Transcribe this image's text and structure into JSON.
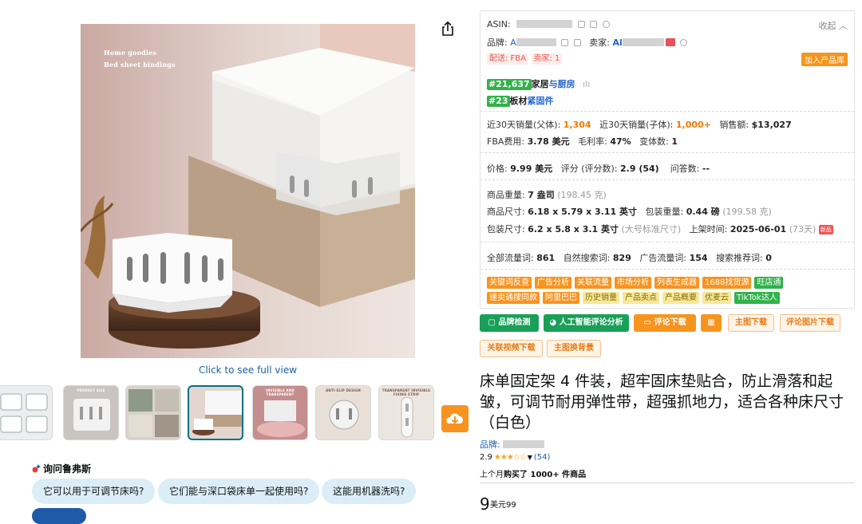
{
  "gallery": {
    "image_text": [
      "Home goodies",
      "Bed sheet bindings"
    ],
    "click_full_view": "Click to see full view",
    "thumbnails": [
      {
        "caption": ""
      },
      {
        "caption": "PRODUCT SIZE"
      },
      {
        "caption": ""
      },
      {
        "caption": "",
        "active": true
      },
      {
        "caption": "INVISIBLE AND TRANSPARENT"
      },
      {
        "caption": "ANTI-SLIP DESIGN"
      },
      {
        "caption": "TRANSPARENT INVISIBLE FIXING STRIP"
      }
    ]
  },
  "rufus": {
    "title": "询问鲁弗斯",
    "questions": [
      "它可以用于可调节床吗?",
      "它们能与深口袋床单一起使用吗?",
      "这能用机器洗吗?"
    ]
  },
  "panel": {
    "asin_label": "ASIN:",
    "collapse": "收起",
    "brand_label": "品牌:",
    "brand_partial": "A",
    "seller_label": "卖家:",
    "seller_partial": "Al",
    "delivery_tag": "配送: FBA",
    "seller_count_tag": "卖家: 1",
    "add_to_library": "加入产品库",
    "rank1": {
      "rank": "#21,637",
      "category_a": "家居",
      "category_b": "与厨房"
    },
    "rank2": {
      "rank": "#23",
      "category_a": "板材",
      "category_b": "紧固件"
    },
    "sales_parent_label": "近30天销量(父体):",
    "sales_parent": "1,304",
    "sales_child_label": "近30天销量(子体):",
    "sales_child": "1,000+",
    "revenue_label": "销售额:",
    "revenue": "$13,027",
    "fba_label": "FBA费用:",
    "fba": "3.78 美元",
    "margin_label": "毛利率:",
    "margin": "47%",
    "variants_label": "变体数:",
    "variants": "1",
    "price_label": "价格:",
    "price": "9.99 美元",
    "rating_label": "评分 (评分数):",
    "rating": "2.9 (54)",
    "qa_label": "问答数:",
    "qa": "--",
    "weight_label": "商品重量:",
    "weight": "7 盎司",
    "weight_g": "(198.45 克)",
    "dims_label": "商品尺寸:",
    "dims": "6.18 x 5.79 x 3.11 英寸",
    "pkg_weight_label": "包装重量:",
    "pkg_weight": "0.44 磅",
    "pkg_weight_g": "(199.58 克)",
    "pkg_dims_label": "包装尺寸:",
    "pkg_dims": "6.2 x 5.8 x 3.1 英寸",
    "pkg_size_class": "(大号标准尺寸)",
    "listed_label": "上架时间:",
    "listed_date": "2025-06-01",
    "listed_days": "(73天)",
    "new_badge": "新品",
    "all_kw_label": "全部流量词:",
    "all_kw": "861",
    "organic_label": "自然搜索词:",
    "organic": "829",
    "ad_label": "广告流量词:",
    "ad": "154",
    "suggest_label": "搜索推荐词:",
    "suggest": "0",
    "tools_row1": [
      {
        "label": "关键词反查",
        "style": "o"
      },
      {
        "label": "广告分析",
        "style": "o"
      },
      {
        "label": "关联流量",
        "style": "o"
      },
      {
        "label": "市场分析",
        "style": "o"
      },
      {
        "label": "列表生成器",
        "style": "o"
      },
      {
        "label": "1688找货源",
        "style": "o"
      },
      {
        "label": "旺店通",
        "style": "g"
      }
    ],
    "tools_row2": [
      {
        "label": "速卖通搜同款",
        "style": "o"
      },
      {
        "label": "阿里巴巴",
        "style": "o"
      },
      {
        "label": "历史销量",
        "style": "y"
      },
      {
        "label": "产品卖点",
        "style": "y"
      },
      {
        "label": "产品概要",
        "style": "y"
      },
      {
        "label": "优麦云",
        "style": "y"
      },
      {
        "label": "TikTok达人",
        "style": "g"
      }
    ],
    "btn_brand_check": "品牌检测",
    "btn_ai_review": "人工智能评论分析",
    "btn_review_download": "评论下载",
    "btn_main_img": "主图下载",
    "btn_review_img": "评论图片下载",
    "btn_video": "关联视频下载",
    "btn_bg": "主图换背景"
  },
  "product": {
    "title": "床单固定架 4 件装，超牢固床垫贴合，防止滑落和起皱，可调节耐用弹性带，超强抓地力，适合各种床尺寸（白色）",
    "brand_label": "品牌:",
    "rating_value": "2.9",
    "stars": "★★★☆☆",
    "rating_count": "(54)",
    "bought_prefix": "上个月",
    "bought_text": "购买了 1000+ 件商品",
    "price_whole": "9",
    "price_currency": "美元",
    "price_fraction": "99"
  }
}
